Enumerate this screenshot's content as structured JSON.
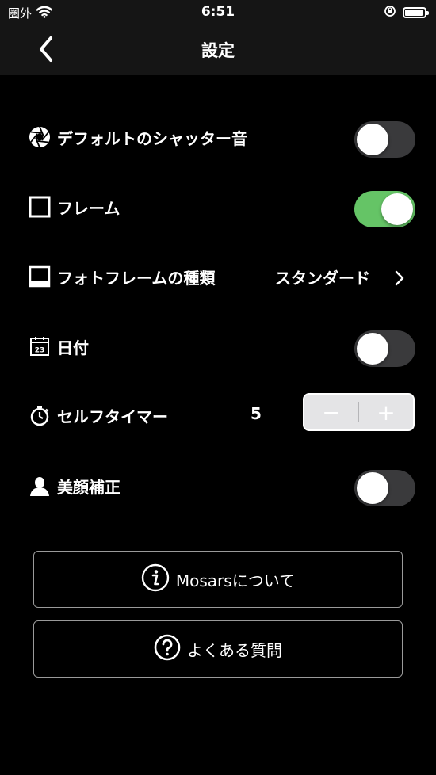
{
  "status_bar": {
    "carrier": "圏外",
    "time": "6:51",
    "battery_level": 0.9
  },
  "nav": {
    "title": "設定",
    "back_icon": "chevron-left-icon"
  },
  "settings": {
    "shutter_sound": {
      "label": "デフォルトのシャッター音",
      "icon": "shutter-icon",
      "enabled": false
    },
    "frame": {
      "label": "フレーム",
      "icon": "square-icon",
      "enabled": true
    },
    "photo_frame_type": {
      "label": "フォトフレームの種類",
      "icon": "frame-icon",
      "value": "スタンダード"
    },
    "date": {
      "label": "日付",
      "icon": "calendar-icon",
      "calendar_number": "23",
      "enabled": false
    },
    "self_timer": {
      "label": "セルフタイマー",
      "icon": "stopwatch-icon",
      "value": "5",
      "decrement": "−",
      "increment": "+"
    },
    "beauty": {
      "label": "美顔補正",
      "icon": "person-icon",
      "enabled": false
    }
  },
  "buttons": {
    "about": {
      "label": "Mosarsについて",
      "icon": "info-icon"
    },
    "faq": {
      "label": "よくある質問",
      "icon": "question-icon"
    }
  },
  "colors": {
    "toggle_on": "#65c466",
    "toggle_off": "#3a3a3c",
    "background": "#000000",
    "bar": "#151515"
  }
}
